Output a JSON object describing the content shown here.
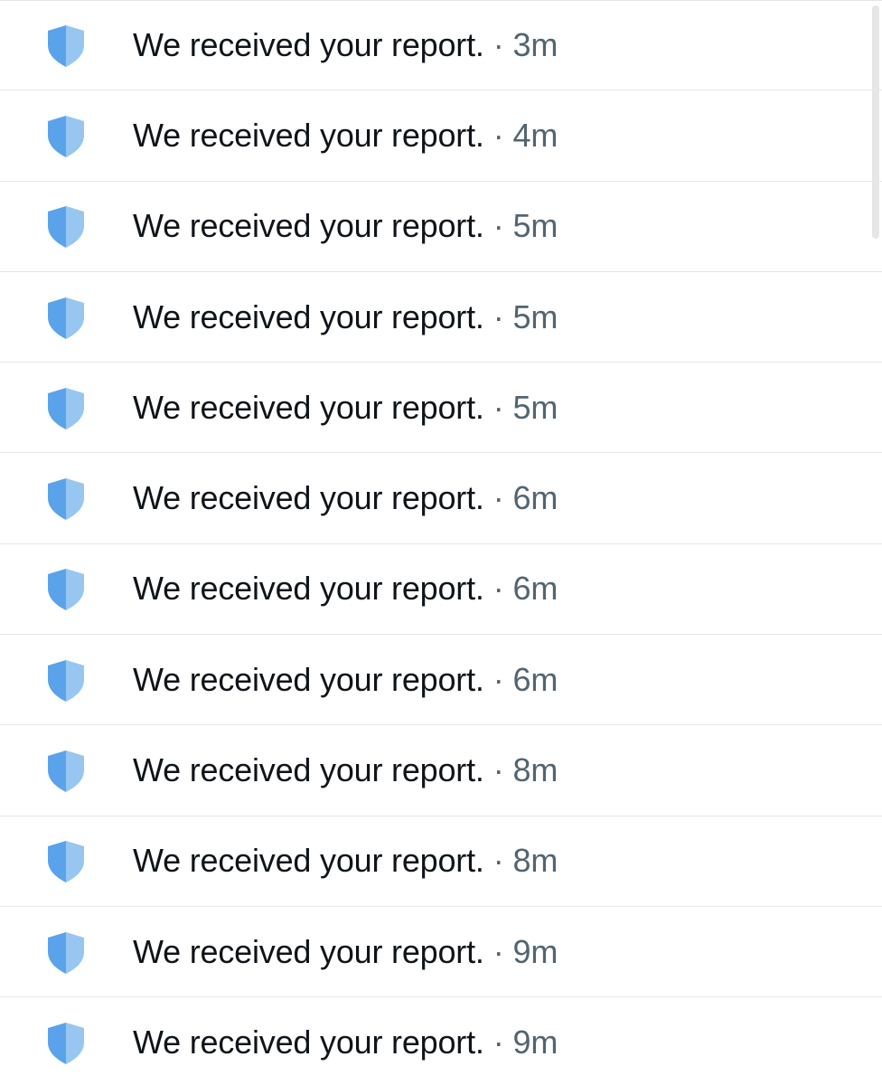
{
  "notifications": [
    {
      "message": "We received your report.",
      "separator": "·",
      "time": "3m"
    },
    {
      "message": "We received your report.",
      "separator": "·",
      "time": "4m"
    },
    {
      "message": "We received your report.",
      "separator": "·",
      "time": "5m"
    },
    {
      "message": "We received your report.",
      "separator": "·",
      "time": "5m"
    },
    {
      "message": "We received your report.",
      "separator": "·",
      "time": "5m"
    },
    {
      "message": "We received your report.",
      "separator": "·",
      "time": "6m"
    },
    {
      "message": "We received your report.",
      "separator": "·",
      "time": "6m"
    },
    {
      "message": "We received your report.",
      "separator": "·",
      "time": "6m"
    },
    {
      "message": "We received your report.",
      "separator": "·",
      "time": "8m"
    },
    {
      "message": "We received your report.",
      "separator": "·",
      "time": "8m"
    },
    {
      "message": "We received your report.",
      "separator": "·",
      "time": "9m"
    },
    {
      "message": "We received your report.",
      "separator": "·",
      "time": "9m"
    }
  ],
  "icon": "shield-icon",
  "colors": {
    "shield_dark": "#5aa3eb",
    "shield_light": "#97c6f1",
    "text": "#0f1419",
    "muted": "#536471",
    "divider": "#e3e7ea"
  }
}
